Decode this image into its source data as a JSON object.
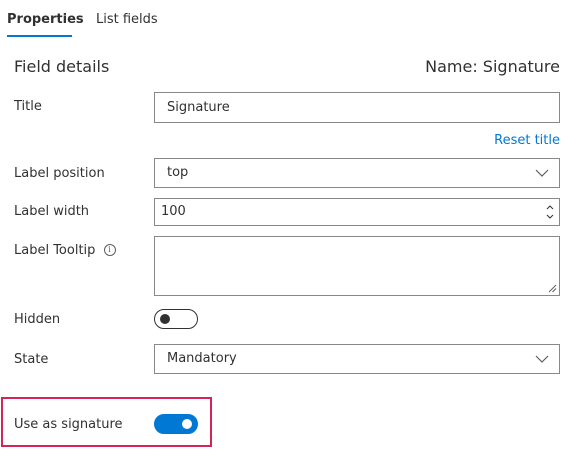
{
  "tabs": [
    {
      "label": "Properties",
      "active": true
    },
    {
      "label": "List fields",
      "active": false
    }
  ],
  "header": {
    "section_title": "Field details",
    "name_text": "Name: Signature"
  },
  "form": {
    "title_label": "Title",
    "title_value": "Signature",
    "reset_title_link": "Reset title",
    "label_position_label": "Label position",
    "label_position_value": "top",
    "label_width_label": "Label width",
    "label_width_value": "100",
    "label_tooltip_label": "Label Tooltip",
    "label_tooltip_value": "",
    "hidden_label": "Hidden",
    "hidden_on": false,
    "state_label": "State",
    "state_value": "Mandatory",
    "use_as_signature_label": "Use as signature",
    "use_as_signature_on": true
  },
  "colors": {
    "accent": "#0078d4",
    "highlight": "#d4255b",
    "border": "#8a8886",
    "text": "#323130"
  },
  "icons": {
    "dropdown": "chevron-down-icon",
    "tooltip": "info-icon",
    "spinner": "number-spinner-icon",
    "resize": "resize-grip-icon"
  }
}
